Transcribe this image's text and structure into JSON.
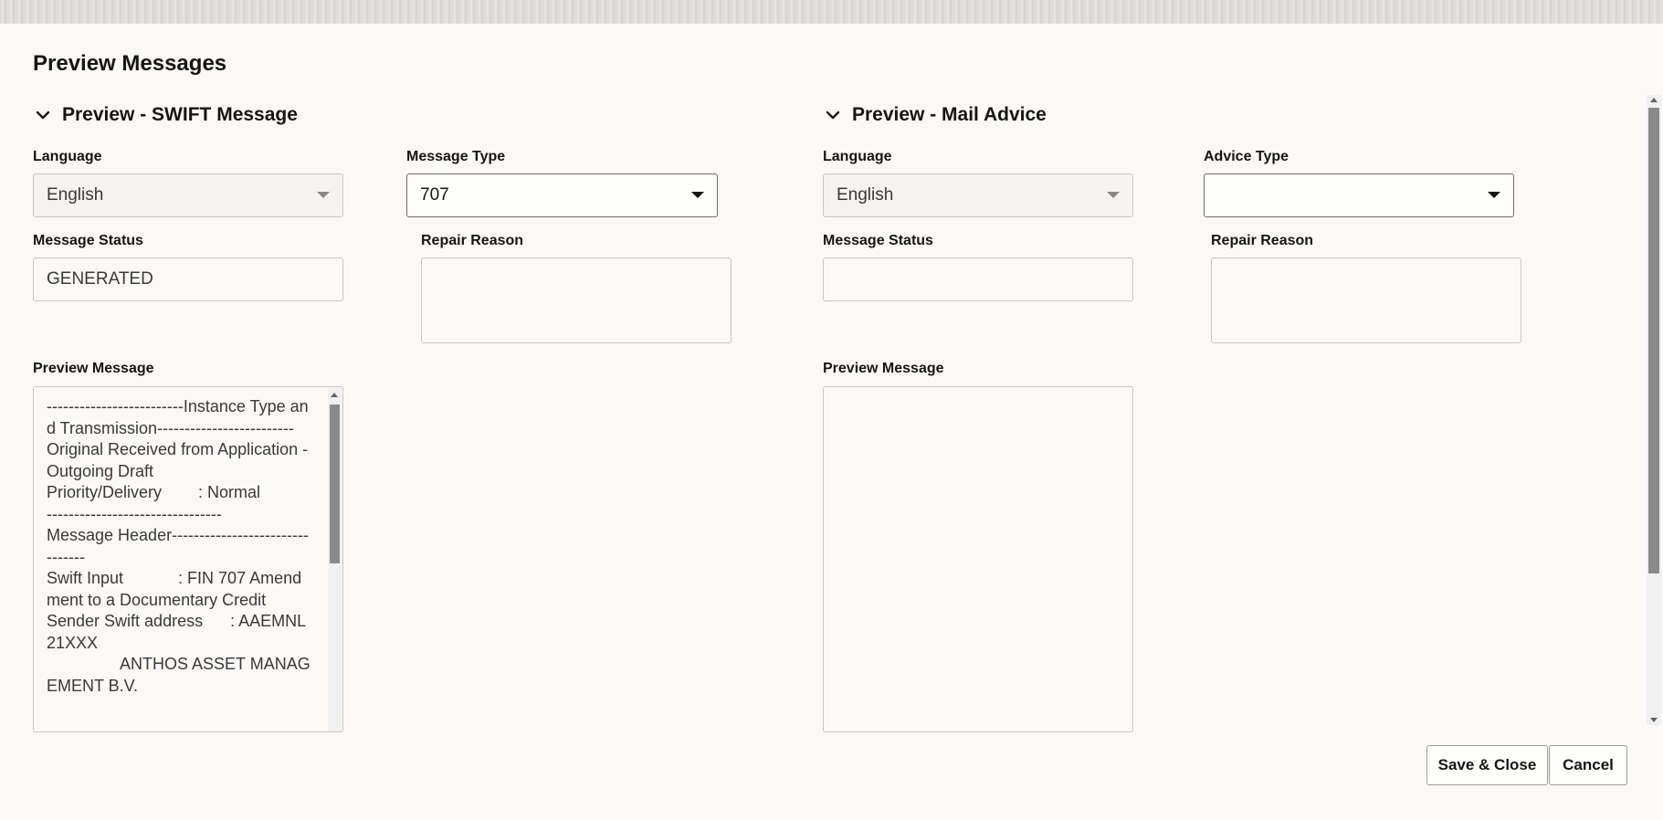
{
  "dialog": {
    "title": "Preview Messages"
  },
  "swift": {
    "section_title": "Preview - SWIFT Message",
    "language_label": "Language",
    "language_value": "English",
    "message_type_label": "Message Type",
    "message_type_value": "707",
    "message_status_label": "Message Status",
    "message_status_value": "GENERATED",
    "repair_reason_label": "Repair Reason",
    "repair_reason_value": "",
    "preview_label": "Preview Message",
    "preview_text": "-------------------------Instance Type and Transmission-------------------------\nOriginal Received from Application - Outgoing Draft\nPriority/Delivery        : Normal\n--------------------------------\nMessage Header--------------------------------\nSwift Input            : FIN 707 Amendment to a Documentary Credit\nSender Swift address      : AAEMNL21XXX\n                ANTHOS ASSET MANAGEMENT B.V."
  },
  "mail": {
    "section_title": "Preview - Mail Advice",
    "language_label": "Language",
    "language_value": "English",
    "advice_type_label": "Advice Type",
    "advice_type_value": "",
    "message_status_label": "Message Status",
    "message_status_value": "",
    "repair_reason_label": "Repair Reason",
    "repair_reason_value": "",
    "preview_label": "Preview Message",
    "preview_text": ""
  },
  "footer": {
    "save_close_label": "Save & Close",
    "cancel_label": "Cancel"
  },
  "icons": {
    "section_toggle": "chevron-down-icon",
    "dropdown": "caret-down-icon"
  }
}
